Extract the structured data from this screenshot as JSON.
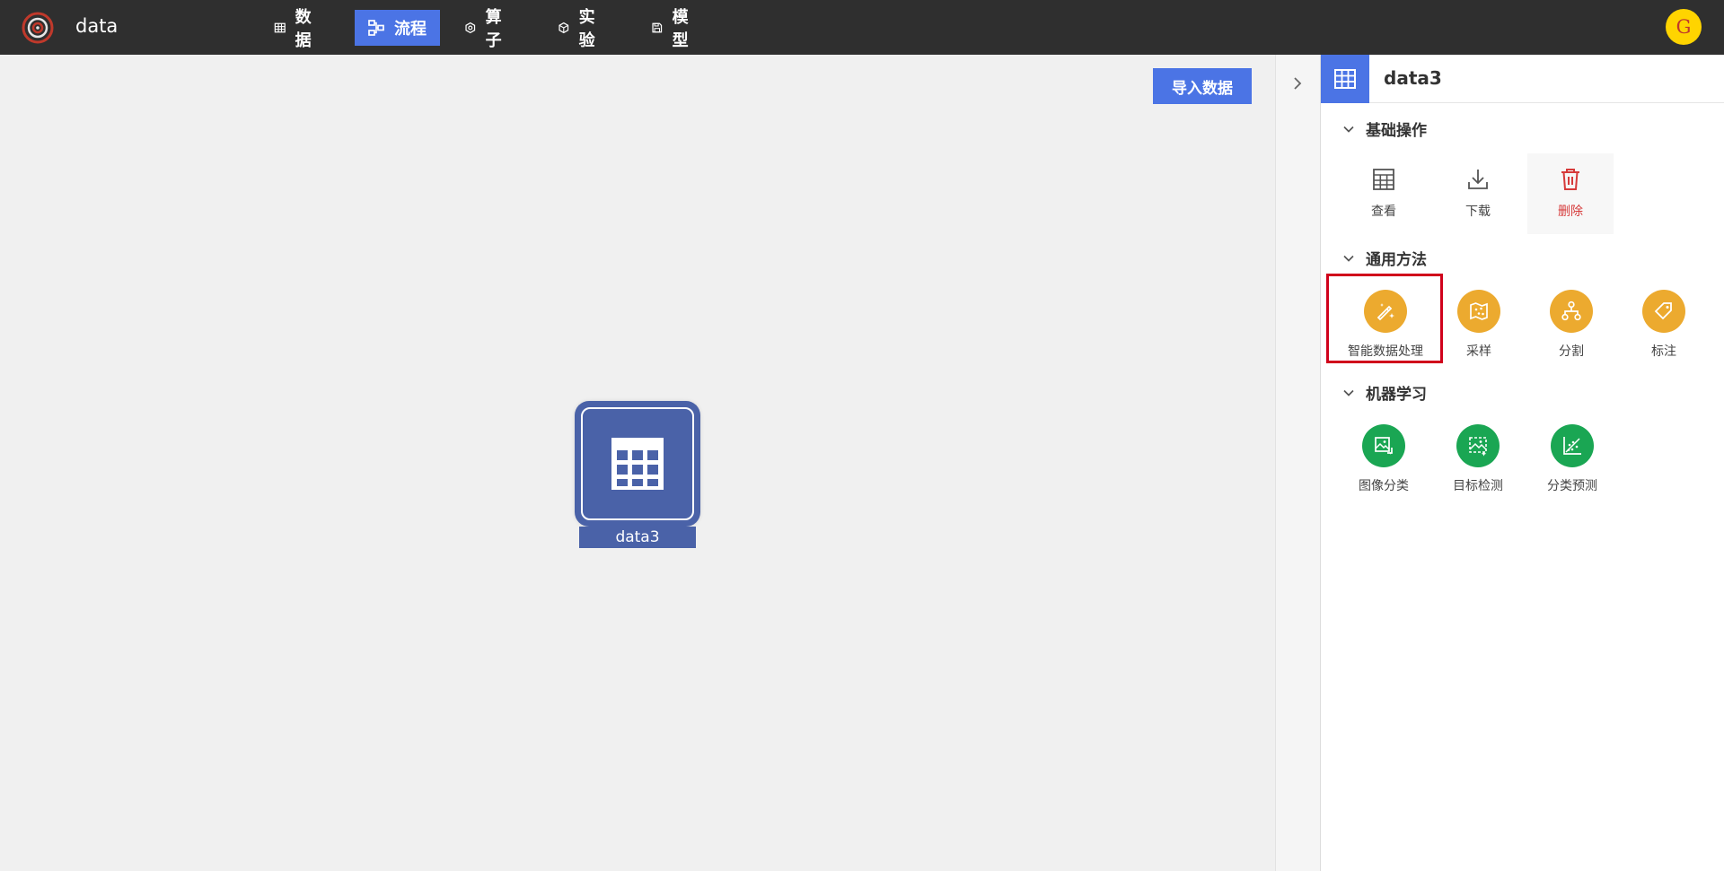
{
  "app": {
    "title": "data",
    "logo": "swirl-logo"
  },
  "nav": [
    {
      "label": "数据",
      "icon": "table-icon"
    },
    {
      "label": "流程",
      "icon": "flow-icon",
      "active": true
    },
    {
      "label": "算子",
      "icon": "hexagon-icon"
    },
    {
      "label": "实验",
      "icon": "cube-icon"
    },
    {
      "label": "模型",
      "icon": "save-icon"
    }
  ],
  "user": {
    "avatar_letter": "G"
  },
  "canvas": {
    "import_button": "导入数据",
    "node": {
      "label": "data3",
      "icon": "table-icon"
    }
  },
  "panel": {
    "title": "data3",
    "sections": {
      "basic": {
        "title": "基础操作",
        "items": [
          {
            "label": "查看",
            "icon": "table-icon"
          },
          {
            "label": "下载",
            "icon": "download-icon"
          },
          {
            "label": "删除",
            "icon": "trash-icon"
          }
        ]
      },
      "general": {
        "title": "通用方法",
        "items": [
          {
            "label": "智能数据处理",
            "icon": "magic-wand-icon"
          },
          {
            "label": "采样",
            "icon": "map-icon"
          },
          {
            "label": "分割",
            "icon": "split-icon"
          },
          {
            "label": "标注",
            "icon": "tag-icon"
          }
        ]
      },
      "ml": {
        "title": "机器学习",
        "items": [
          {
            "label": "图像分类",
            "icon": "image-classify-icon"
          },
          {
            "label": "目标检测",
            "icon": "object-detect-icon"
          },
          {
            "label": "分类预测",
            "icon": "scatter-chart-icon"
          }
        ]
      }
    }
  },
  "colors": {
    "topbar": "#2f2f2f",
    "accent": "#4b74e5",
    "node": "#4a62a8",
    "orange": "#ecaa2f",
    "green": "#1aa653",
    "danger": "#d63a3a",
    "highlight": "#d0021b"
  }
}
